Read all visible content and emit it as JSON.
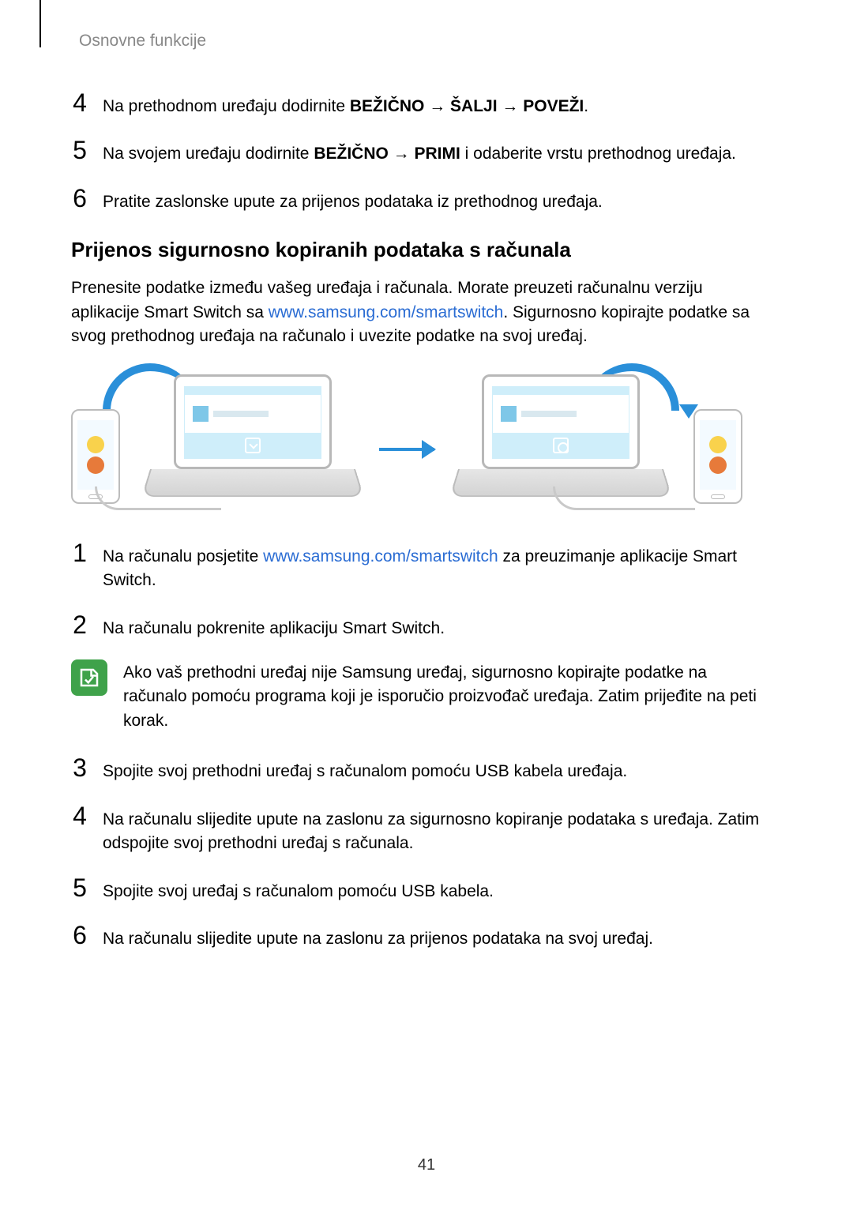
{
  "breadcrumb": "Osnovne funkcije",
  "topSteps": {
    "s4": {
      "num": "4",
      "pre": "Na prethodnom uređaju dodirnite ",
      "b1": "BEŽIČNO",
      "arrow1": " → ",
      "b2": "ŠALJI",
      "arrow2": " → ",
      "b3": "POVEŽI",
      "post": "."
    },
    "s5": {
      "num": "5",
      "pre": "Na svojem uređaju dodirnite ",
      "b1": "BEŽIČNO",
      "arrow1": " → ",
      "b2": "PRIMI",
      "post": " i odaberite vrstu prethodnog uređaja."
    },
    "s6": {
      "num": "6",
      "text": "Pratite zaslonske upute za prijenos podataka iz prethodnog uređaja."
    }
  },
  "subheading": "Prijenos sigurnosno kopiranih podataka s računala",
  "intro": {
    "pre": "Prenesite podatke između vašeg uređaja i računala. Morate preuzeti računalnu verziju aplikacije Smart Switch sa ",
    "link": "www.samsung.com/smartswitch",
    "post": ". Sigurnosno kopirajte podatke sa svog prethodnog uređaja na računalo i uvezite podatke na svoj uređaj."
  },
  "steps": {
    "s1": {
      "num": "1",
      "pre": "Na računalu posjetite ",
      "link": "www.samsung.com/smartswitch",
      "post": " za preuzimanje aplikacije Smart Switch."
    },
    "s2": {
      "num": "2",
      "text": "Na računalu pokrenite aplikaciju Smart Switch."
    },
    "s3": {
      "num": "3",
      "text": "Spojite svoj prethodni uređaj s računalom pomoću USB kabela uređaja."
    },
    "s4": {
      "num": "4",
      "text": "Na računalu slijedite upute na zaslonu za sigurnosno kopiranje podataka s uređaja. Zatim odspojite svoj prethodni uređaj s računala."
    },
    "s5": {
      "num": "5",
      "text": "Spojite svoj uređaj s računalom pomoću USB kabela."
    },
    "s6": {
      "num": "6",
      "text": "Na računalu slijedite upute na zaslonu za prijenos podataka na svoj uređaj."
    }
  },
  "note": "Ako vaš prethodni uređaj nije Samsung uređaj, sigurnosno kopirajte podatke na računalo pomoću programa koji je isporučio proizvođač uređaja. Zatim prijeđite na peti korak.",
  "pageNumber": "41"
}
